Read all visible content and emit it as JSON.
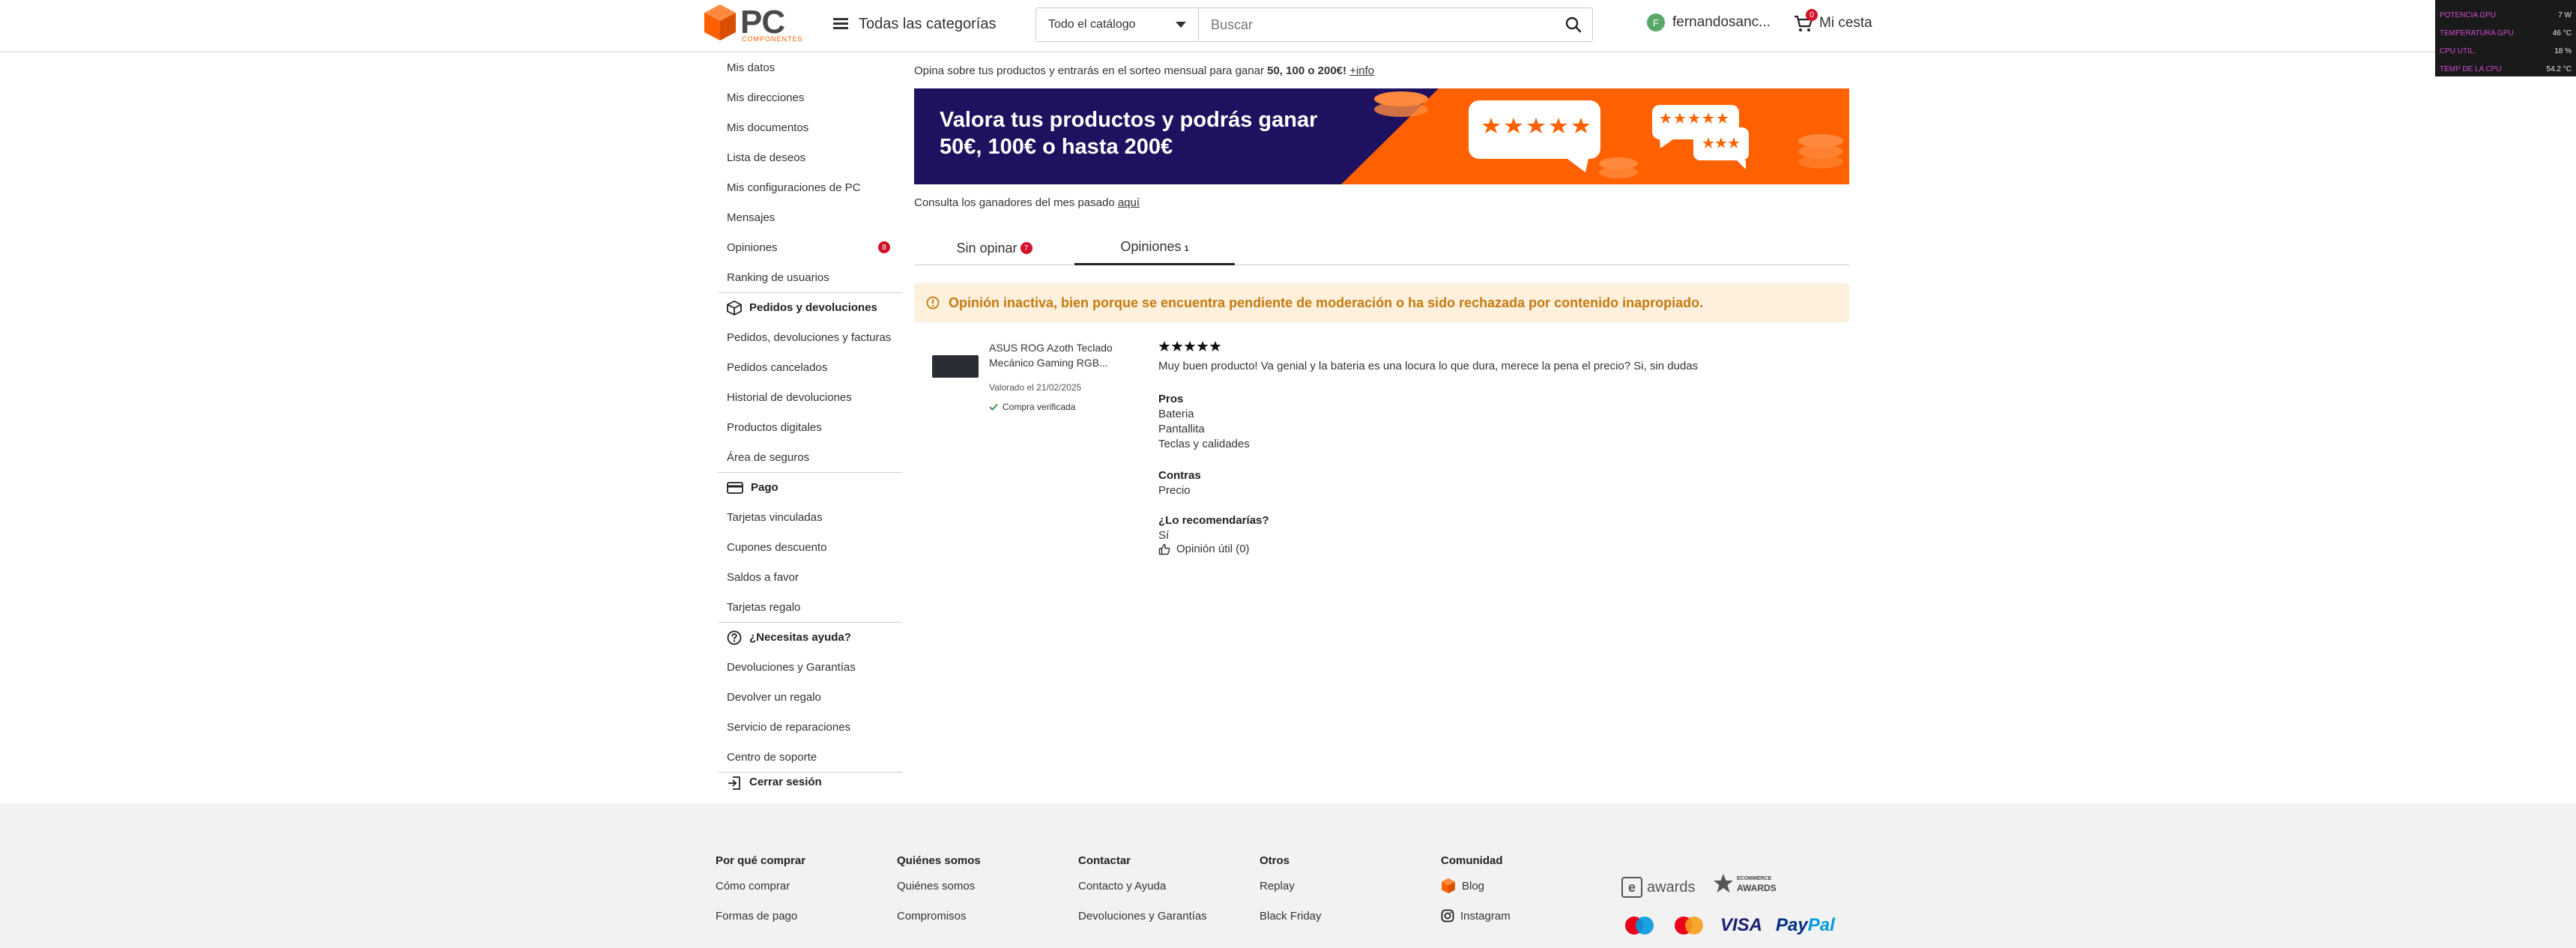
{
  "header": {
    "logo_text": "PC",
    "logo_sub": "COMPONENTES",
    "categories_label": "Todas las categorías",
    "search_scope": "Todo el catálogo",
    "search_placeholder": "Buscar",
    "user_initial": "F",
    "user_name": "fernandosanc...",
    "cart_label": "Mi cesta",
    "cart_count": "0"
  },
  "monitor": {
    "rows": [
      {
        "label": "POTENCIA GPU",
        "value": "7 W"
      },
      {
        "label": "TEMPERATURA GPU",
        "value": "46 °C"
      },
      {
        "label": "CPU UTIL.",
        "value": "18 %"
      },
      {
        "label": "TEMP DE LA CPU",
        "value": "54.2 °C"
      }
    ]
  },
  "sidebar": {
    "top_items": [
      "Mis datos",
      "Mis direcciones",
      "Mis documentos",
      "Lista de deseos",
      "Mis configuraciones de PC",
      "Mensajes",
      "Opiniones",
      "Ranking de usuarios"
    ],
    "opiniones_badge": "8",
    "orders_title": "Pedidos y devoluciones",
    "orders_items": [
      "Pedidos, devoluciones y facturas",
      "Pedidos cancelados",
      "Historial de devoluciones",
      "Productos digitales",
      "Área de seguros"
    ],
    "payment_title": "Pago",
    "payment_items": [
      "Tarjetas vinculadas",
      "Cupones descuento",
      "Saldos a favor",
      "Tarjetas regalo"
    ],
    "help_title": "¿Necesitas ayuda?",
    "help_items": [
      "Devoluciones y Garantías",
      "Devolver un regalo",
      "Servicio de reparaciones",
      "Centro de soporte"
    ],
    "logout": "Cerrar sesión"
  },
  "main": {
    "promo_prefix": "Opina sobre tus productos y entrarás en el sorteo mensual para ganar ",
    "promo_amounts": "50, 100 o 200€!",
    "promo_link": "+info",
    "banner_line1": "Valora tus productos y podrás ganar",
    "banner_line2": "50€, 100€ o hasta 200€",
    "winners_text": "Consulta los ganadores del mes pasado ",
    "winners_link": "aquí",
    "tab_pending": "Sin opinar",
    "tab_pending_badge": "7",
    "tab_reviews": "Opiniones",
    "tab_reviews_count": "1",
    "alert_text": "Opinión inactiva, bien porque se encuentra pendiente de moderación o ha sido rechazada por contenido inapropiado.",
    "review": {
      "product_line1": "ASUS ROG Azoth Teclado",
      "product_line2": "Mecánico Gaming RGB...",
      "date": "Valorado el 21/02/2025",
      "verified": "Compra verificada",
      "rating": 5,
      "text": "Muy buen producto! Va genial y la bateria es una locura lo que dura, merece la pena el precio? Si, sin dudas",
      "pros_title": "Pros",
      "pros": [
        "Bateria",
        "Pantallita",
        "Teclas y calidades"
      ],
      "cons_title": "Contras",
      "cons": [
        "Precio"
      ],
      "recommend_title": "¿Lo recomendarías?",
      "recommend_value": "Sí",
      "useful": "Opinión útil (0)"
    }
  },
  "footer": {
    "columns": [
      {
        "title": "Por qué comprar",
        "links": [
          "Cómo comprar",
          "Formas de pago"
        ]
      },
      {
        "title": "Quiénes somos",
        "links": [
          "Quiénes somos",
          "Compromisos"
        ]
      },
      {
        "title": "Contactar",
        "links": [
          "Contacto y Ayuda",
          "Devoluciones y Garantías"
        ]
      },
      {
        "title": "Otros",
        "links": [
          "Replay",
          "Black Friday"
        ]
      },
      {
        "title": "Comunidad",
        "links": [
          "Blog",
          "Instagram"
        ]
      }
    ],
    "eawards": "awards",
    "ecommerce_line1": "ECOMMERCE",
    "ecommerce_line2": "AWARDS",
    "visa": "VISA",
    "paypal_a": "Pay",
    "paypal_b": "Pal"
  },
  "colors": {
    "brand_orange": "#ff6000",
    "banner_navy": "#1d1160",
    "badge_red": "#d0112b",
    "alert_bg": "#fdf0dc",
    "alert_text": "#c47a10"
  }
}
